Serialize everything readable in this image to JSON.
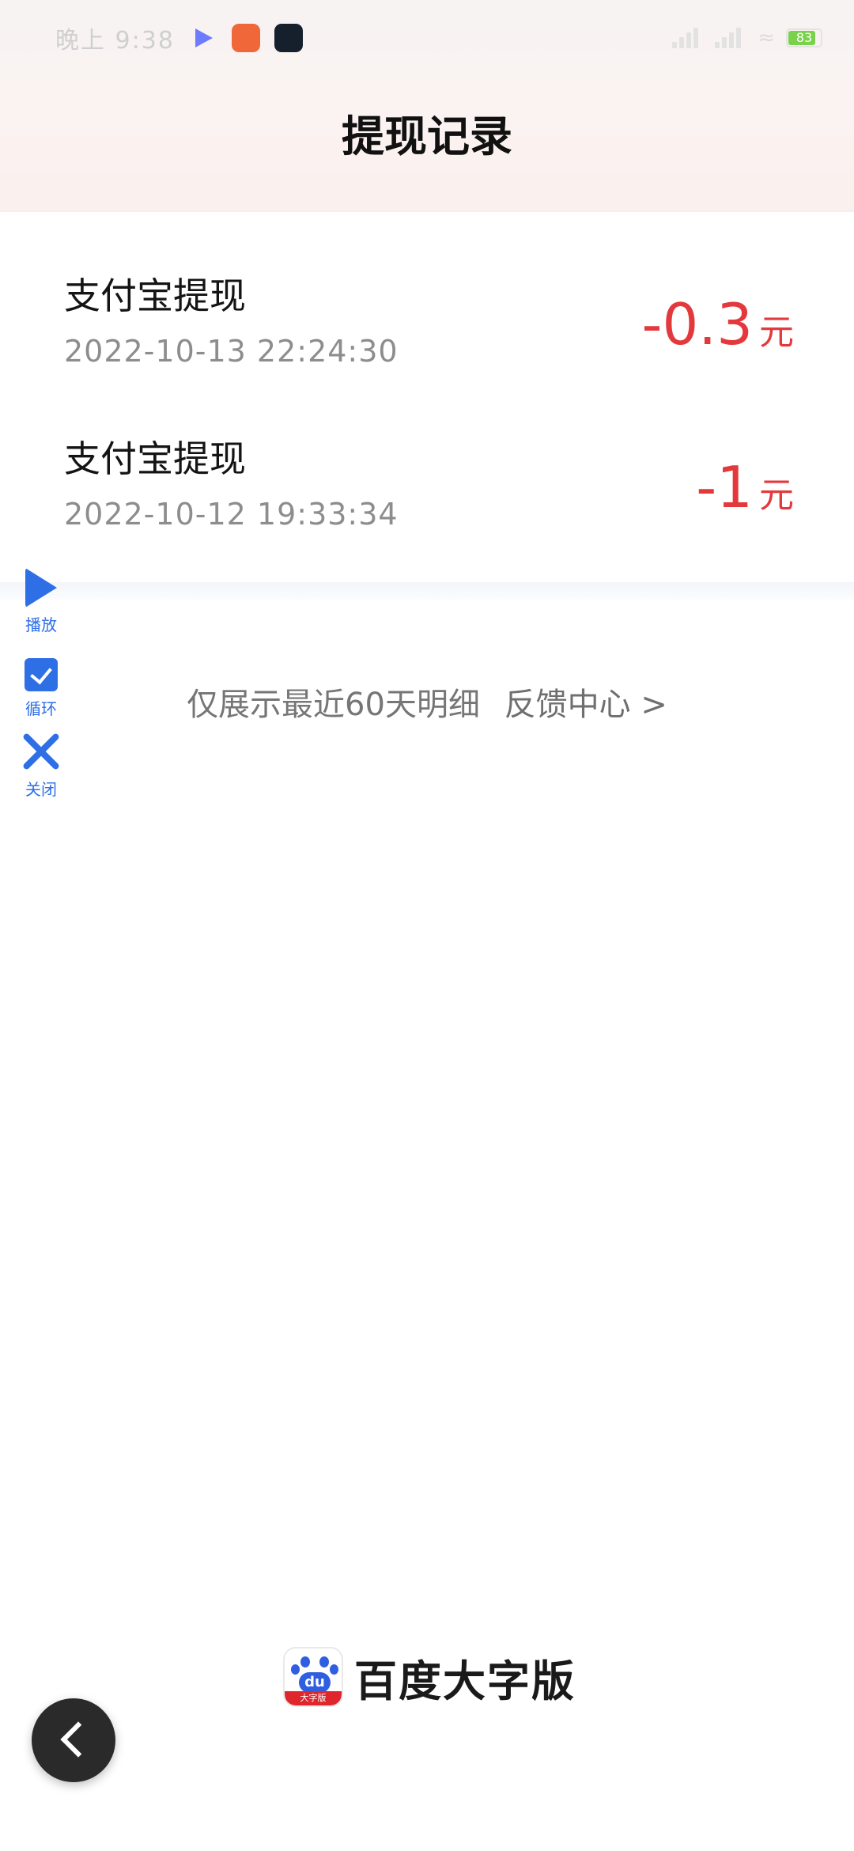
{
  "status_bar": {
    "time": "晚上 9:38",
    "battery": "83",
    "app_icons": [
      "video-play-icon",
      "orange-app-icon",
      "dark-app-icon"
    ]
  },
  "header": {
    "title": "提现记录"
  },
  "records": [
    {
      "title": "支付宝提现",
      "time": "2022-10-13 22:24:30",
      "amount": "-0.3",
      "unit": "元"
    },
    {
      "title": "支付宝提现",
      "time": "2022-10-12 19:33:34",
      "amount": "-1",
      "unit": "元"
    }
  ],
  "footer": {
    "note": "仅展示最近60天明细",
    "feedback_link": "反馈中心 >"
  },
  "side_controls": {
    "play_label": "播放",
    "loop_label": "循环",
    "close_label": "关闭"
  },
  "brand": {
    "name": "百度大字版",
    "logo_text": "du",
    "logo_band": "大字版"
  },
  "colors": {
    "amount": "#e4393c",
    "accent": "#2e6fe6",
    "title": "#111111",
    "secondary_text": "#8d8d8d"
  }
}
